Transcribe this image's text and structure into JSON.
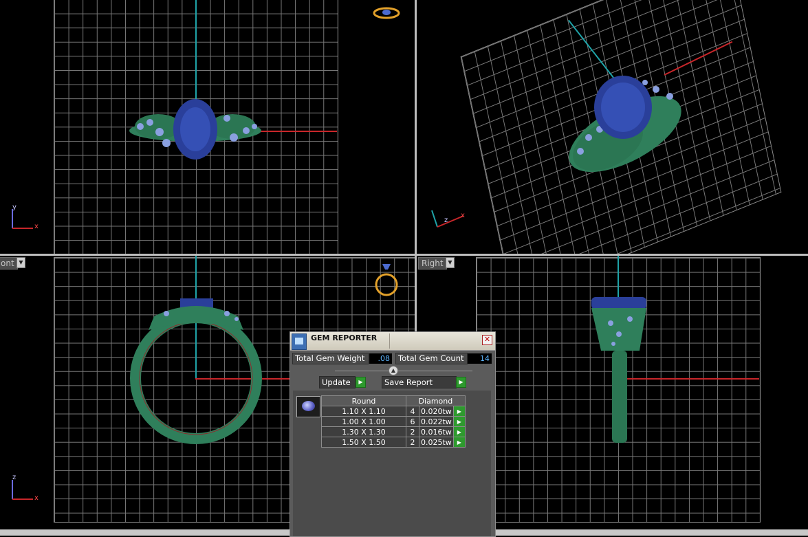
{
  "viewports": {
    "front_label": "ont",
    "right_label": "Right",
    "top_triad": {
      "axis1": "y",
      "axis2": "x"
    },
    "persp_triad": {
      "axis1": "z",
      "axis2": "x"
    },
    "front_triad": {
      "axis1": "z",
      "axis2": "x"
    }
  },
  "gem_reporter": {
    "title": "GEM REPORTER",
    "close_glyph": "✕",
    "total_gem_weight_label": "Total Gem Weight",
    "total_gem_weight": ".08",
    "total_gem_count_label": "Total Gem Count",
    "total_gem_count": "14",
    "update_label": "Update",
    "save_report_label": "Save Report",
    "gem_shape": "Round",
    "gem_type": "Diamond",
    "rows": [
      {
        "size": "1.10 X 1.10",
        "count": "4",
        "weight": "0.020tw"
      },
      {
        "size": "1.00 X 1.00",
        "count": "6",
        "weight": "0.022tw"
      },
      {
        "size": "1.30 X 1.30",
        "count": "2",
        "weight": "0.016tw"
      },
      {
        "size": "1.50 X 1.50",
        "count": "2",
        "weight": "0.025tw"
      }
    ]
  },
  "colors": {
    "metal": "#2f7f5b",
    "center_stone": "#2a3f9a",
    "accent_stones": "#8aa0e0",
    "axis_x": "#c8262a",
    "axis_y": "#1fa3a8",
    "go_button": "#2e9a2e"
  }
}
